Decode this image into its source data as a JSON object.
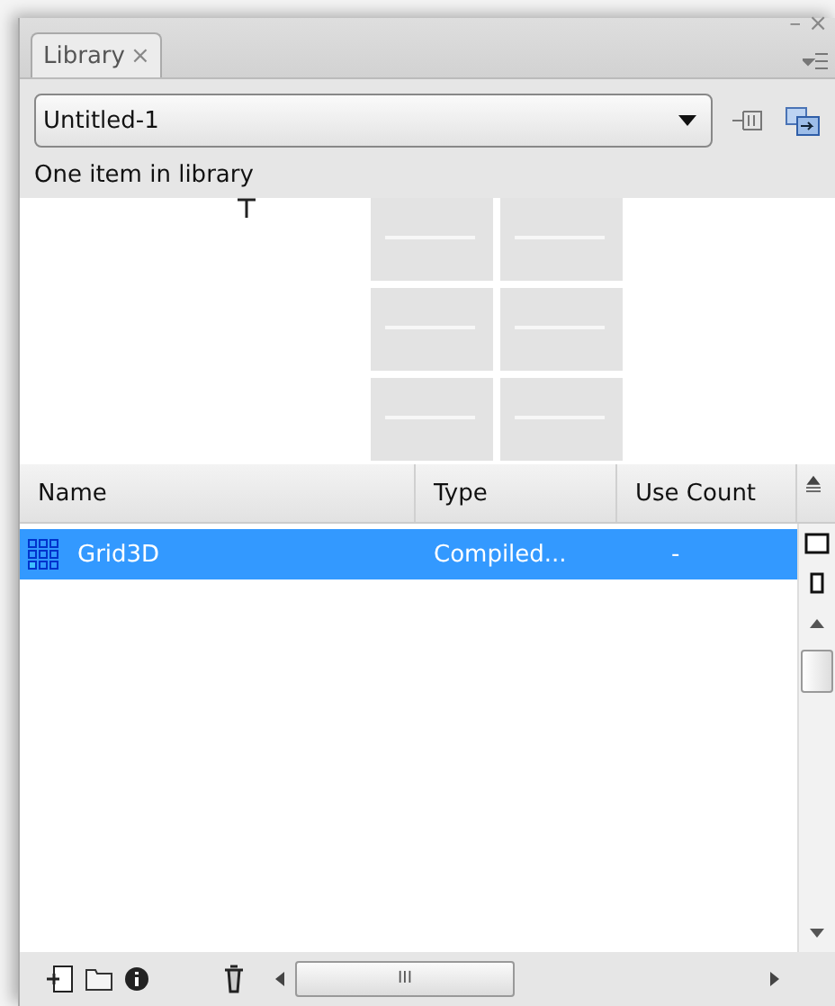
{
  "window": {
    "controls": [
      "–",
      "×"
    ]
  },
  "tabs": [
    {
      "label": "Library",
      "close": "×",
      "selected": true
    }
  ],
  "document_select": {
    "value": "Untitled-1"
  },
  "status": "One item in library",
  "table": {
    "columns": [
      "Name",
      "Type",
      "Use Count"
    ],
    "rows": [
      {
        "name": "Grid3D",
        "type": "Compiled...",
        "use_count": "-",
        "selected": true
      }
    ]
  },
  "horizontal_scrollbar": {
    "grip": "III"
  }
}
